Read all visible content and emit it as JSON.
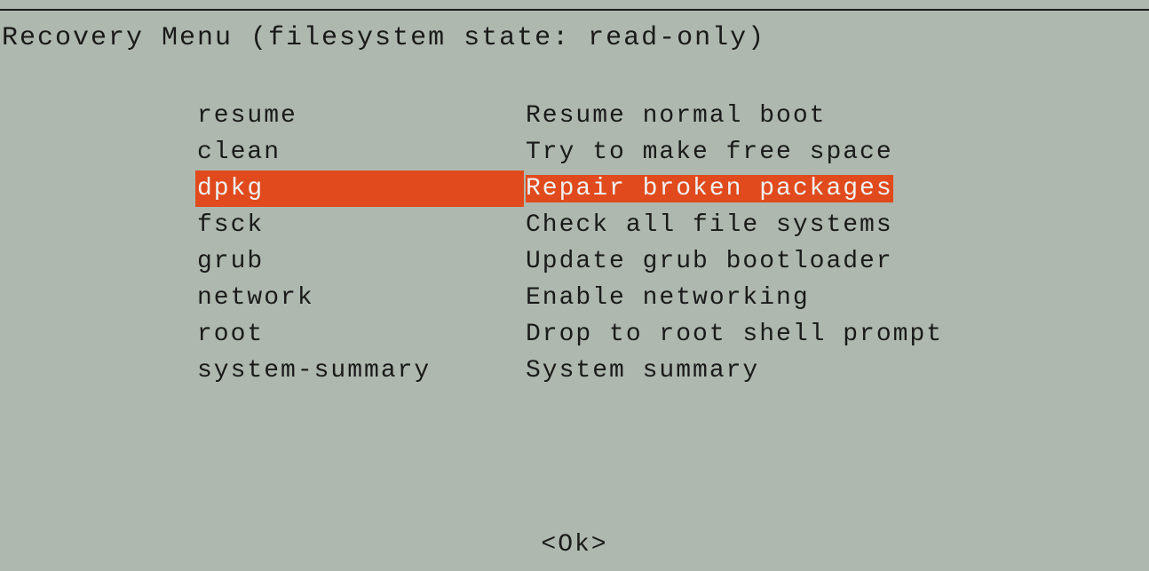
{
  "title": "Recovery Menu (filesystem state: read-only)",
  "menu": {
    "selected_index": 2,
    "items": [
      {
        "key": "resume",
        "desc": "Resume normal boot"
      },
      {
        "key": "clean",
        "desc": "Try to make free space"
      },
      {
        "key": "dpkg",
        "desc": "Repair broken packages"
      },
      {
        "key": "fsck",
        "desc": "Check all file systems"
      },
      {
        "key": "grub",
        "desc": "Update grub bootloader"
      },
      {
        "key": "network",
        "desc": "Enable networking"
      },
      {
        "key": "root",
        "desc": "Drop to root shell prompt"
      },
      {
        "key": "system-summary",
        "desc": "System summary"
      }
    ]
  },
  "ok_label": "<Ok>"
}
